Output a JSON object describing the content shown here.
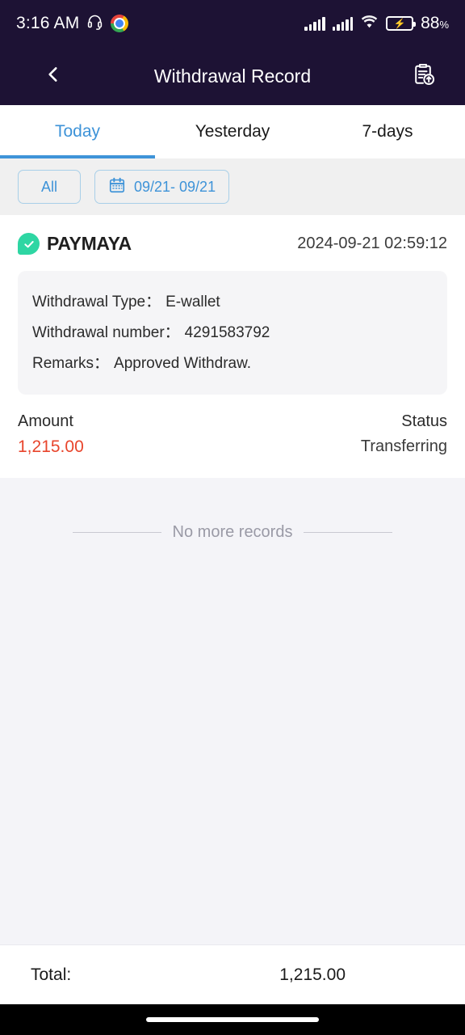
{
  "status_bar": {
    "time": "3:16 AM",
    "battery_percent": "88",
    "percent_symbol": "%",
    "icons": [
      "headphones-icon",
      "chrome-icon",
      "signal-bars-icon",
      "signal-bars-icon",
      "wifi-icon",
      "battery-charging-icon"
    ]
  },
  "app_bar": {
    "title": "Withdrawal Record",
    "back_icon": "chevron-left-icon",
    "export_icon": "clipboard-export-icon",
    "background": "#1d1234"
  },
  "tabs": {
    "active_index": 0,
    "accent": "#3e93d8",
    "items": [
      {
        "label": "Today"
      },
      {
        "label": "Yesterday"
      },
      {
        "label": "7-days"
      }
    ]
  },
  "filters": {
    "all_label": "All",
    "date_range": "09/21- 09/21",
    "calendar_icon": "calendar-icon"
  },
  "records": [
    {
      "brand": "PAYMAYA",
      "brand_color": "#2ed6a3",
      "timestamp": "2024-09-21 02:59:12",
      "details": [
        {
          "label": "Withdrawal Type：",
          "value": "E-wallet"
        },
        {
          "label": "Withdrawal number：",
          "value": "4291583792"
        },
        {
          "label": "Remarks：",
          "value": "Approved Withdraw."
        }
      ],
      "amount_label": "Amount",
      "amount_value": "1,215.00",
      "amount_color": "#e8452c",
      "status_label": "Status",
      "status_value": "Transferring"
    }
  ],
  "list_end": {
    "text": "No more records"
  },
  "footer": {
    "total_label": "Total:",
    "total_value": "1,215.00"
  }
}
